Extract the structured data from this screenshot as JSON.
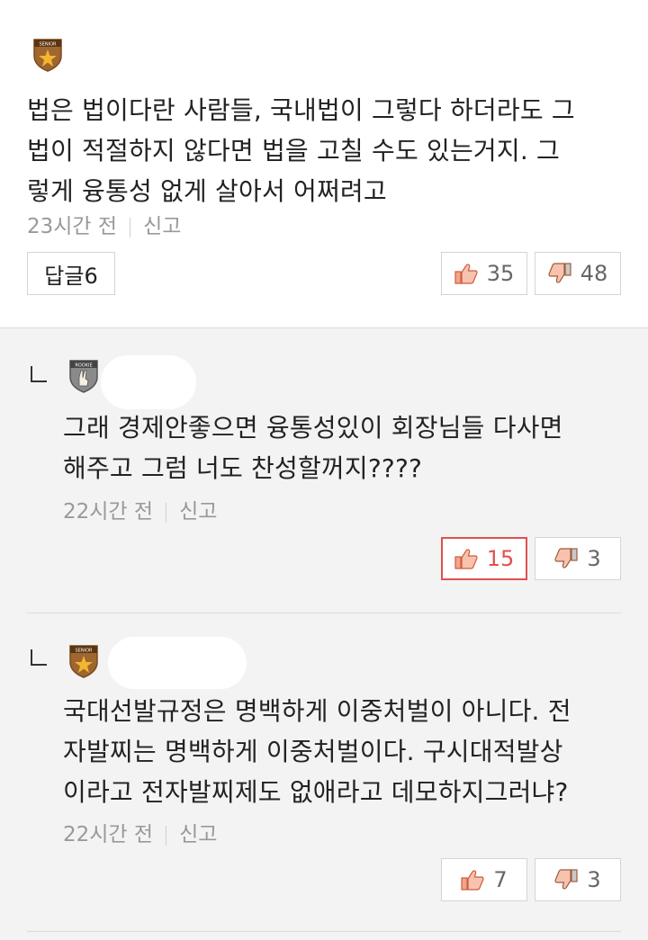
{
  "main": {
    "badge": "senior-badge-icon",
    "text_lines": [
      "법은 법이다란 사람들, 국내법이 그렇다 하더라도 그",
      "법이 적절하지 않다면 법을 고칠 수도 있는거지. 그",
      "렇게 융통성 없게 살아서 어쩌려고"
    ],
    "time": "23시간 전",
    "report": "신고",
    "reply_button": "답글6",
    "likes": "35",
    "dislikes": "48"
  },
  "replies": [
    {
      "badge": "rookie-badge-icon",
      "text_lines": [
        "그래 경제안좋으면 융통성있이 회장님들 다사면",
        "해주고 그럼 너도 찬성할꺼지????"
      ],
      "time": "22시간 전",
      "report": "신고",
      "likes": "15",
      "dislikes": "3",
      "liked": true
    },
    {
      "badge": "senior-badge-icon",
      "text_lines": [
        "국대선발규정은 명백하게 이중처벌이 아니다. 전",
        "자발찌는 명백하게 이중처벌이다. 구시대적발상",
        "이라고 전자발찌제도 없애라고 데모하지그러냐?"
      ],
      "time": "22시간 전",
      "report": "신고",
      "likes": "7",
      "dislikes": "3",
      "liked": false
    }
  ],
  "colors": {
    "like_active": "#e05050",
    "badge_brown": "#a0662f",
    "star_gold": "#f2b630"
  }
}
